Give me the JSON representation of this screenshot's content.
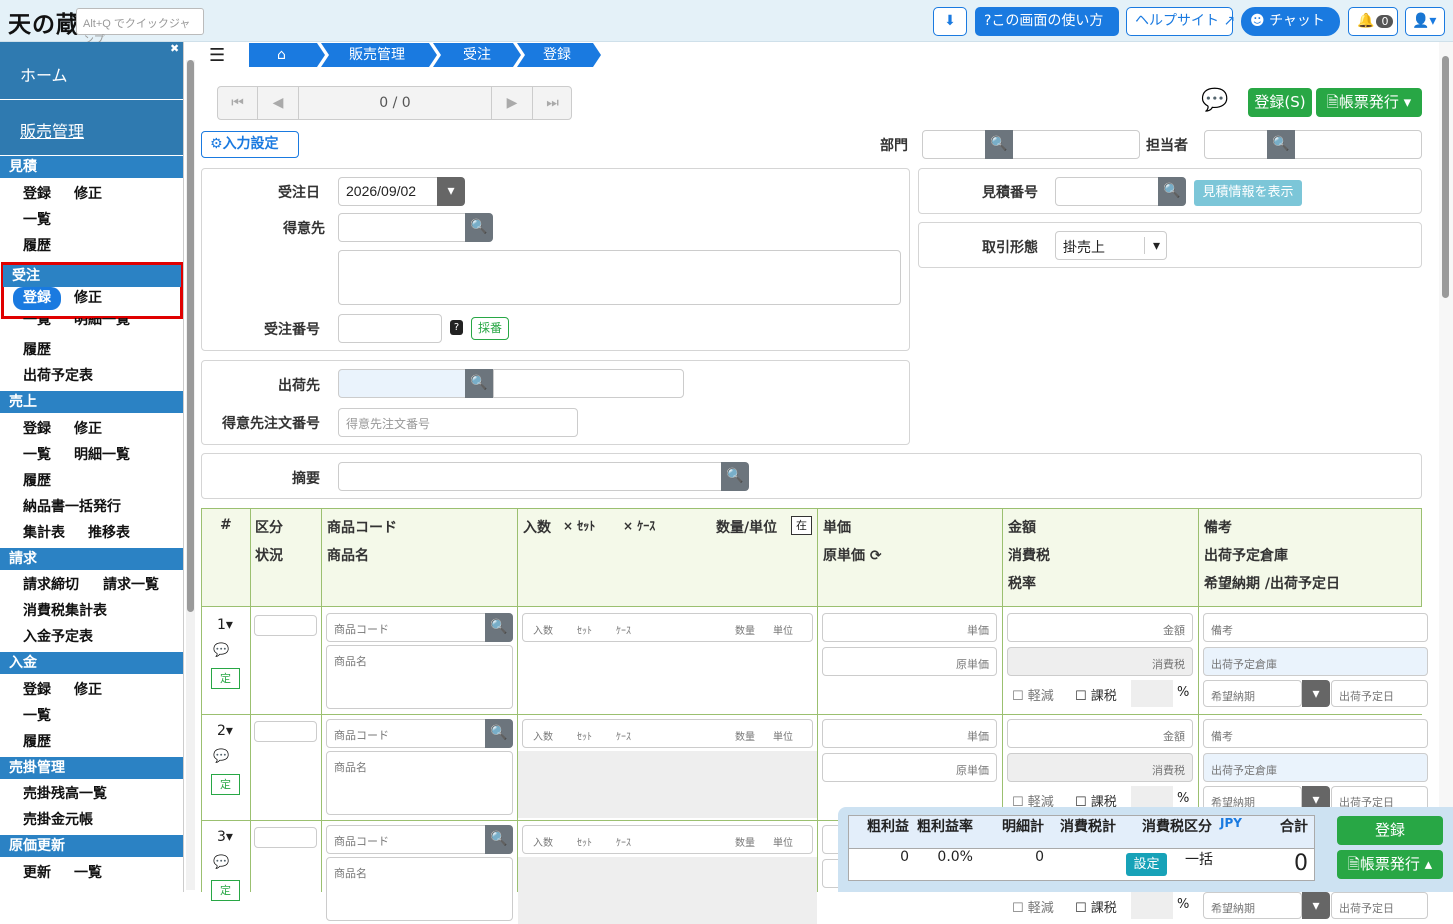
{
  "topbar": {
    "logo": "天の蔵",
    "quickjump_placeholder": "Alt+Q でクイックジャンプ",
    "help_label": "?この画面の使い方",
    "helpsite_label": "ヘルプサイト",
    "chat_label": "チャット",
    "notify_count": "0"
  },
  "sidebar": {
    "home": "ホーム",
    "sales": "販売管理",
    "mitsumori": {
      "head": "見積",
      "items": [
        "登録",
        "修正",
        "一覧",
        "履歴"
      ]
    },
    "juchu": {
      "head": "受注",
      "items": [
        "登録",
        "修正",
        "一覧",
        "明細一覧",
        "履歴",
        "出荷予定表"
      ]
    },
    "uriage": {
      "head": "売上",
      "items": [
        "登録",
        "修正",
        "一覧",
        "明細一覧",
        "履歴",
        "納品書一括発行",
        "集計表",
        "推移表"
      ]
    },
    "seikyu": {
      "head": "請求",
      "items": [
        "請求締切",
        "請求一覧",
        "消費税集計表",
        "入金予定表"
      ]
    },
    "nyukin": {
      "head": "入金",
      "items": [
        "登録",
        "修正",
        "一覧",
        "履歴"
      ]
    },
    "urikake": {
      "head": "売掛管理",
      "items": [
        "売掛残高一覧",
        "売掛金元帳"
      ]
    },
    "genka": {
      "head": "原価更新",
      "items": [
        "更新",
        "一覧"
      ]
    }
  },
  "breadcrumb": [
    "販売管理",
    "受注",
    "登録"
  ],
  "pager": {
    "text": "0 / 0"
  },
  "actions": {
    "register": "登録(S)",
    "issue": "帳票発行"
  },
  "input_settings": "入力設定",
  "header_fields": {
    "dept": "部門",
    "staff": "担当者",
    "order_date_label": "受注日",
    "order_date": "2026/09/02",
    "customer": "得意先",
    "order_no": "受注番号",
    "saiban": "採番",
    "estimate_no": "見積番号",
    "show_estimate": "見積情報を表示",
    "deal_type_label": "取引形態",
    "deal_type": "掛売上",
    "ship_to": "出荷先",
    "cust_order_no": "得意先注文番号",
    "cust_order_no_ph": "得意先注文番号",
    "memo": "摘要"
  },
  "table": {
    "h_no": "#",
    "h_kubun": "区分",
    "h_status": "状況",
    "h_code": "商品コード",
    "h_name": "商品名",
    "h_qty": "入数",
    "h_set": "× ｾｯﾄ",
    "h_case": "× ｹｰｽ",
    "h_qtyunit": "数量/単位",
    "h_zai": "在",
    "h_price": "単価",
    "h_cost": "原単価",
    "h_amount": "金額",
    "h_tax": "消費税",
    "h_rate": "税率",
    "h_note": "備考",
    "h_wh": "出荷予定倉庫",
    "h_date": "希望納期 /出荷予定日",
    "ph": {
      "code": "商品コード",
      "name": "商品名",
      "irisu": "入数",
      "set": "ｾｯﾄ",
      "case": "ｹｰｽ",
      "qty": "数量",
      "unit": "単位",
      "price": "単価",
      "cost": "原単価",
      "amount": "金額",
      "tax": "消費税",
      "reduced": "軽減",
      "taxable": "課税",
      "pct": "%",
      "note": "備考",
      "wh": "出荷予定倉庫",
      "wish": "希望納期",
      "shipdate": "出荷予定日",
      "tei": "定"
    },
    "rows": [
      "1",
      "2",
      "3"
    ]
  },
  "footer": {
    "h_profit": "粗利益",
    "h_rate": "粗利益率",
    "h_detail": "明細計",
    "h_tax": "消費税計",
    "h_taxkind": "消費税区分",
    "h_cur": "JPY",
    "h_total": "合計",
    "profit": "0",
    "rate": "0.0%",
    "detail": "0",
    "tax": "",
    "setting": "設定",
    "ikkatsu": "一括",
    "total": "0",
    "register": "登録",
    "issue": "帳票発行"
  }
}
